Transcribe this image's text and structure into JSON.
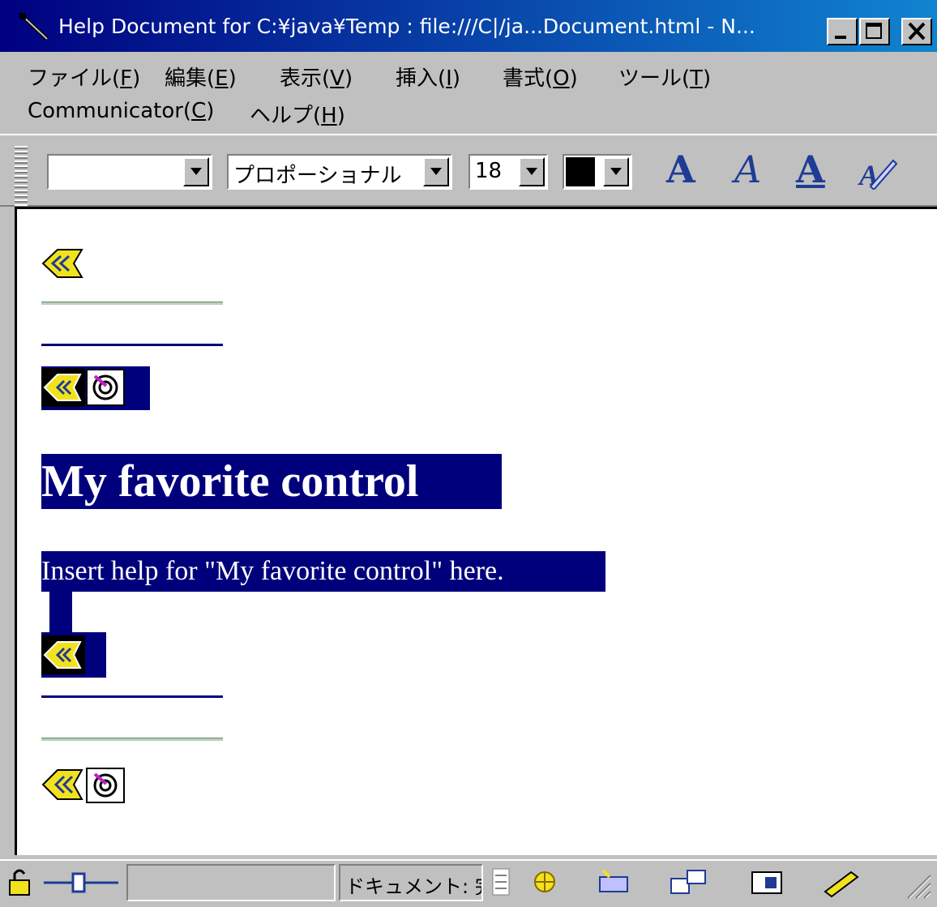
{
  "window": {
    "title": "Help Document for C:¥java¥Temp : file:///C|/ja...Document.html - N...",
    "buttons": {
      "minimize": "minimize",
      "maximize": "maximize",
      "close": "close"
    }
  },
  "menu": {
    "row1": [
      {
        "label": "ファイル(",
        "key": "F",
        "end": ")"
      },
      {
        "label": "編集(",
        "key": "E",
        "end": ")"
      },
      {
        "label": "表示(",
        "key": "V",
        "end": ")"
      },
      {
        "label": "挿入(",
        "key": "I",
        "end": ")"
      },
      {
        "label": "書式(",
        "key": "O",
        "end": ")"
      },
      {
        "label": "ツール(",
        "key": "T",
        "end": ")"
      }
    ],
    "row2": [
      {
        "label": "Communicator(",
        "key": "C",
        "end": ")"
      },
      {
        "label": "ヘルプ(",
        "key": "H",
        "end": ")"
      }
    ]
  },
  "toolbar": {
    "style_value": "",
    "font_value": "プロポーショナル",
    "size_value": "18",
    "color_value": "#000000",
    "bold_label": "A",
    "italic_label": "A",
    "underline_label": "A"
  },
  "document": {
    "heading": "My favorite control",
    "body": "Insert help for \"My favorite control\" here.",
    "selection_color": "#00007c",
    "rule_color": "#00007c",
    "icon_color": "#f2e21e"
  },
  "statusbar": {
    "status_text": "ドキュメント: 完"
  }
}
